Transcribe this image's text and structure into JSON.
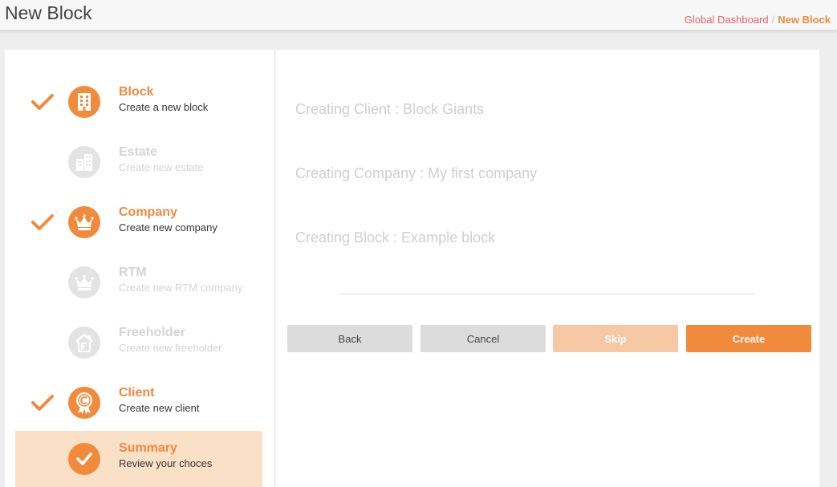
{
  "header": {
    "title": "New Block",
    "breadcrumb": {
      "link": "Global Dashboard",
      "separator": "/",
      "current": "New Block"
    }
  },
  "steps": [
    {
      "title": "Block",
      "subtitle": "Create a new block",
      "state": "done",
      "icon": "building-icon"
    },
    {
      "title": "Estate",
      "subtitle": "Create new estate",
      "state": "disabled",
      "icon": "estate-icon"
    },
    {
      "title": "Company",
      "subtitle": "Create new company",
      "state": "done",
      "icon": "crown-icon"
    },
    {
      "title": "RTM",
      "subtitle": "Create new RTM company",
      "state": "disabled",
      "icon": "crown-icon"
    },
    {
      "title": "Freeholder",
      "subtitle": "Create new freeholder",
      "state": "disabled",
      "icon": "freeholder-house-icon"
    },
    {
      "title": "Client",
      "subtitle": "Create new client",
      "state": "done",
      "icon": "client-badge-icon"
    },
    {
      "title": "Summary",
      "subtitle": "Review your choces",
      "state": "active",
      "icon": "check-icon"
    }
  ],
  "summary": {
    "client": "Creating Client : Block Giants",
    "company": "Creating Company : My first company",
    "block": "Creating Block : Example block"
  },
  "buttons": {
    "back": "Back",
    "cancel": "Cancel",
    "skip": "Skip",
    "create": "Create"
  },
  "colors": {
    "accent": "#f28a3c",
    "accent_light": "#f7c8a4",
    "active_bg": "#fbe0c8",
    "link": "#e8626a",
    "disabled": "#e3e3e3"
  }
}
